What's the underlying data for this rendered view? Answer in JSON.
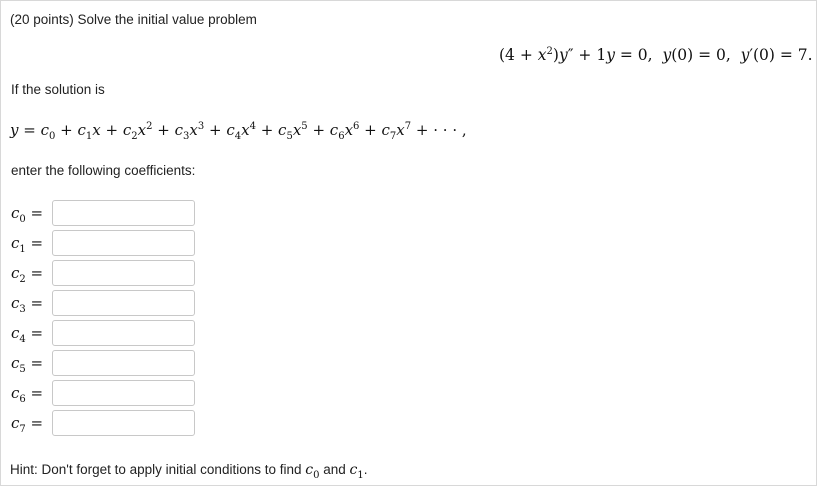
{
  "problem": {
    "title": "(20 points) Solve the initial value problem",
    "if_text": "If the solution is",
    "enter_text": "enter the following coefficients:",
    "hint_prefix": "Hint: Don't forget to apply initial conditions to find",
    "hint_and": "and",
    "hint_end": "."
  },
  "coefficients": [
    {
      "sub": "0",
      "value": ""
    },
    {
      "sub": "1",
      "value": ""
    },
    {
      "sub": "2",
      "value": ""
    },
    {
      "sub": "3",
      "value": ""
    },
    {
      "sub": "4",
      "value": ""
    },
    {
      "sub": "5",
      "value": ""
    },
    {
      "sub": "6",
      "value": ""
    },
    {
      "sub": "7",
      "value": ""
    }
  ]
}
